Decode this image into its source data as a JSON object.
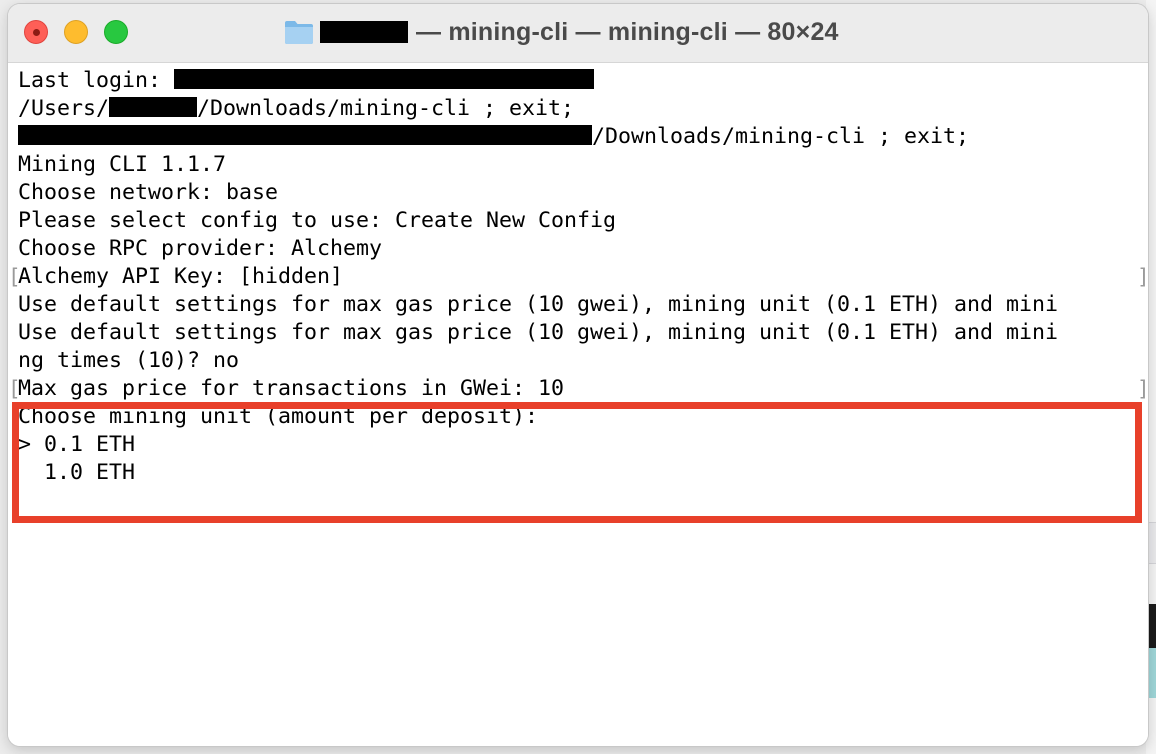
{
  "window": {
    "title": "— mining-cli — mining-cli — 80×24"
  },
  "terminal": {
    "last_login_prefix": "Last login: ",
    "path_prefix": "/Users/",
    "path_suffix": "/Downloads/mining-cli ; exit;",
    "redacted_cmd_suffix": "/Downloads/mining-cli ; exit;",
    "version": "Mining CLI 1.1.7",
    "network": "Choose network: base",
    "config": "Please select config to use: Create New Config",
    "rpc": "Choose RPC provider: Alchemy",
    "api_key": "Alchemy API Key: [hidden]",
    "defaults_1": "Use default settings for max gas price (10 gwei), mining unit (0.1 ETH) and mini",
    "defaults_2": "Use default settings for max gas price (10 gwei), mining unit (0.1 ETH) and mini",
    "defaults_2_wrap": "ng times (10)? no",
    "max_gas": "Max gas price for transactions in GWei: 10",
    "mining_unit_prompt": "Choose mining unit (amount per deposit):",
    "options": [
      "> 0.1 ETH",
      "  1.0 ETH"
    ]
  },
  "colors": {
    "highlight": "#e8402a",
    "close": "#fe5f57",
    "minimize": "#febc2e",
    "maximize": "#28c840"
  },
  "icons": {
    "title_icon": "folder-icon"
  }
}
